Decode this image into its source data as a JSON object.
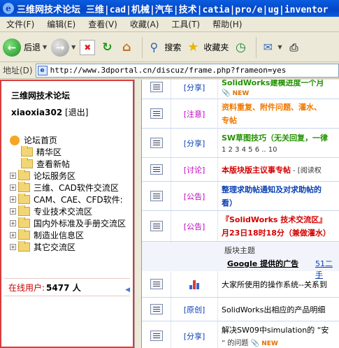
{
  "window": {
    "title": "三维网技术论坛 三维|cad|机械|汽车|技术|catia|pro/e|ug|inventor"
  },
  "menu": [
    "文件(F)",
    "编辑(E)",
    "查看(V)",
    "收藏(A)",
    "工具(T)",
    "帮助(H)"
  ],
  "toolbar": {
    "back_label": "后退",
    "search_label": "搜索",
    "favorites_label": "收藏夹"
  },
  "address": {
    "label": "地址(D)",
    "url": "http://www.3dportal.cn/discuz/frame.php?frameon=yes"
  },
  "left": {
    "forum_title": "三维网技术论坛",
    "username": "xiaoxia302",
    "logout": "[退出]",
    "tree": [
      {
        "label": "论坛首页",
        "type": "home"
      },
      {
        "label": "精华区",
        "type": "leaf"
      },
      {
        "label": "查看新帖",
        "type": "leaf"
      },
      {
        "label": "论坛服务区",
        "type": "folder"
      },
      {
        "label": "三维、CAD软件交流区",
        "type": "folder"
      },
      {
        "label": "CAM、CAE、CFD软件:",
        "type": "folder"
      },
      {
        "label": "专业技术交流区",
        "type": "folder"
      },
      {
        "label": "国内外标准及手册交流区",
        "type": "folder"
      },
      {
        "label": "制造业信息区",
        "type": "folder"
      },
      {
        "label": "其它交流区",
        "type": "folder"
      }
    ],
    "online_label": "在线用户:",
    "online_count": "5477 人"
  },
  "threads": [
    {
      "cat": "[分享]",
      "subject": "SolidWorks建模进度一个月",
      "sub": "NEW"
    },
    {
      "cat": "[注意]",
      "subject": "资料重复、附件问题、灌水、",
      "sub": "专帖"
    },
    {
      "cat": "[分享]",
      "subject": "SW草图技巧（无关回复，一律",
      "sub": "1 2 3 4 5 6 .. 10"
    },
    {
      "cat": "[讨论]",
      "subject": "本版块版主议事专帖",
      "sub": "- [阅读权"
    },
    {
      "cat": "[公告]",
      "subject": "整理求助帖通知及对求助帖的",
      "sub": "看）"
    },
    {
      "cat": "[公告]",
      "subject": "『SolidWorks 技术交流区』",
      "sub": "月23日18时18分（兼做灌水）"
    }
  ],
  "section": {
    "label": "版块主题",
    "ad": "Google 提供的广告",
    "ad_link": "51二手"
  },
  "threads2": [
    {
      "cat": "",
      "subject": "大家所使用的操作系统--关系到"
    },
    {
      "cat": "[原创]",
      "subject": "SolidWorks出相应的产品明细"
    },
    {
      "cat": "[分享]",
      "subject": "解决SW09中simulation的 “安",
      "sub": "” 的问题"
    }
  ],
  "colors": {
    "title_bar": "#0a5ddf",
    "left_border": "#d73d3d",
    "link_blue": "#0a40b4"
  }
}
